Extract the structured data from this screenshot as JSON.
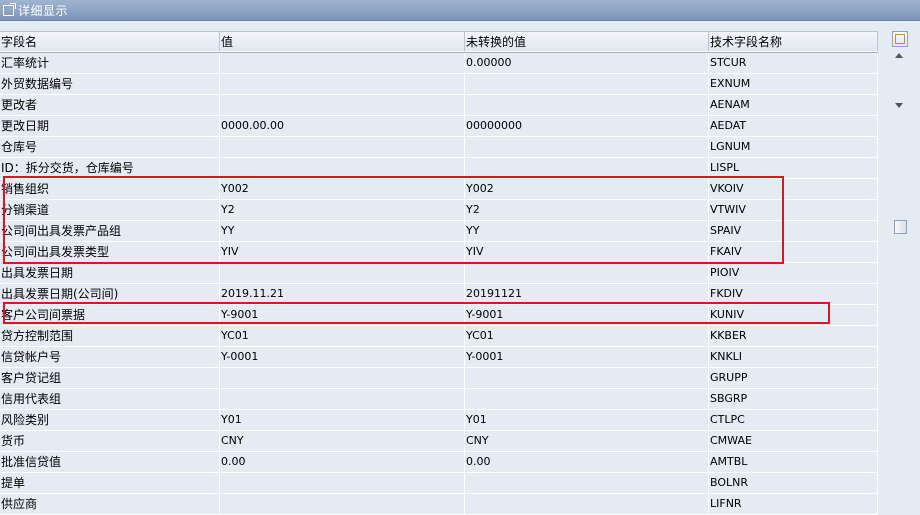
{
  "window": {
    "title": "详细显示"
  },
  "table": {
    "headers": [
      "字段名",
      "值",
      "未转换的值",
      "技术字段名称"
    ],
    "rows": [
      [
        "汇率统计",
        "",
        "0.00000",
        "STCUR"
      ],
      [
        "外贸数据编号",
        "",
        "",
        "EXNUM"
      ],
      [
        "更改者",
        "",
        "",
        "AENAM"
      ],
      [
        "更改日期",
        "0000.00.00",
        "00000000",
        "AEDAT"
      ],
      [
        "仓库号",
        "",
        "",
        "LGNUM"
      ],
      [
        "ID：拆分交货，仓库编号",
        "",
        "",
        "LISPL"
      ],
      [
        "销售组织",
        "Y002",
        "Y002",
        "VKOIV"
      ],
      [
        "分销渠道",
        "Y2",
        "Y2",
        "VTWIV"
      ],
      [
        "公司间出具发票产品组",
        "YY",
        "YY",
        "SPAIV"
      ],
      [
        "公司间出具发票类型",
        "YIV",
        "YIV",
        "FKAIV"
      ],
      [
        "出具发票日期",
        "",
        "",
        "PIOIV"
      ],
      [
        "出具发票日期(公司间)",
        "2019.11.21",
        "20191121",
        "FKDIV"
      ],
      [
        "客户公司间票据",
        "Y-9001",
        "Y-9001",
        "KUNIV"
      ],
      [
        "贷方控制范围",
        "YC01",
        "YC01",
        "KKBER"
      ],
      [
        "信贷帐户号",
        "Y-0001",
        "Y-0001",
        "KNKLI"
      ],
      [
        "客户贷记组",
        "",
        "",
        "GRUPP"
      ],
      [
        "信用代表组",
        "",
        "",
        "SBGRP"
      ],
      [
        "风险类别",
        "Y01",
        "Y01",
        "CTLPC"
      ],
      [
        "货币",
        "CNY",
        "CNY",
        "CMWAE"
      ],
      [
        "批准信贷值",
        "0.00",
        "0.00",
        "AMTBL"
      ],
      [
        "提单",
        "",
        "",
        "BOLNR"
      ],
      [
        "供应商",
        "",
        "",
        "LIFNR"
      ]
    ]
  },
  "colors": {
    "highlight": "#e0141e",
    "row_bg": "#e4ebf3",
    "titlebar": "#8aa0c0"
  },
  "icons": {
    "title": "edit-window-icon",
    "column_settings": "column-layout-icon"
  }
}
